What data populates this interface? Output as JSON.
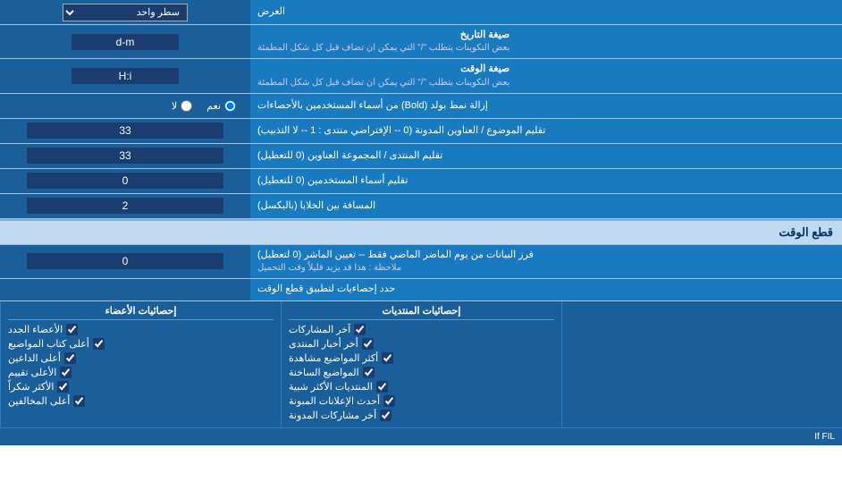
{
  "rows": [
    {
      "id": "ard",
      "label": "العرض",
      "inputType": "dropdown",
      "options": [
        "سطر واحد"
      ],
      "value": "سطر واحد"
    },
    {
      "id": "date-format",
      "label": "صيغة التاريخ\nبعض التكوينات يتطلب \"/\" التي يمكن ان تضاف قبل كل شكل المطمئة",
      "inputType": "text",
      "value": "d-m"
    },
    {
      "id": "time-format",
      "label": "صيغة الوقت\nبعض التكوينات يتطلب \"/\" التي يمكن ان تضاف قبل كل شكل المطمئة",
      "inputType": "text",
      "value": "H:i"
    },
    {
      "id": "bold-remove",
      "label": "إزالة نمط بولد (Bold) من أسماء المستخدمين بالأحصاءات",
      "inputType": "radio",
      "options": [
        "نعم",
        "لا"
      ],
      "value": "نعم"
    },
    {
      "id": "topics-titles",
      "label": "تقليم الموضوع / العناوين المدونة (0 -- الإفتراضي منتدى : 1 -- لا التذبيب)",
      "inputType": "number",
      "value": "33"
    },
    {
      "id": "forum-titles",
      "label": "تقليم المنتدى / المجموعة العناوين (0 للتعطيل)",
      "inputType": "number",
      "value": "33"
    },
    {
      "id": "members-names",
      "label": "تقليم أسماء المستخدمين (0 للتعطيل)",
      "inputType": "number",
      "value": "0"
    },
    {
      "id": "cells-gap",
      "label": "المسافة بين الخلايا (بالبكسل)",
      "inputType": "number",
      "value": "2"
    }
  ],
  "cutTimeSection": {
    "header": "قطع الوقت",
    "row": {
      "label": "فرز البيانات من يوم الماضر الماضي فقط -- تعيين الماشر (0 لتعطيل)",
      "note": "ملاحظة : هذا قد يزيد قليلاً وقت التحميل",
      "value": "0"
    },
    "statsHeader": "حدد إحصاءيات لتطبيق قطع الوقت"
  },
  "checkboxColumns": [
    {
      "header": "إحصائيات الأعضاء",
      "items": [
        "الأعضاء الجدد",
        "أعلى كتاب المواضيع",
        "أعلى الداعين",
        "الأعلى تقييم",
        "الأكثر شكراً",
        "أعلى المخالفين"
      ]
    },
    {
      "header": "إحصائيات المنتديات",
      "items": [
        "آخر المشاركات",
        "أخر أخبار المنتدى",
        "أكثر المواضيع مشاهدة",
        "المواضيع الساخنة",
        "المنتديات الأكثر شبية",
        "أحدث الإعلانات المبونة",
        "أخر مشاركات المدونة"
      ]
    }
  ],
  "dateFormatLabel1": "صيغة التاريخ",
  "dateFormatLabel2": "بعض التكوينات يتطلب \"/\" التي يمكن ان تضاف قبل كل شكل المطمئة",
  "timeFormatLabel1": "صيغة الوقت",
  "timeFormatLabel2": "بعض التكوينات يتطلب \"/\" التي يمكن ان تضاف قبل كل شكل المطمئة",
  "ifFIL": "If FIL"
}
